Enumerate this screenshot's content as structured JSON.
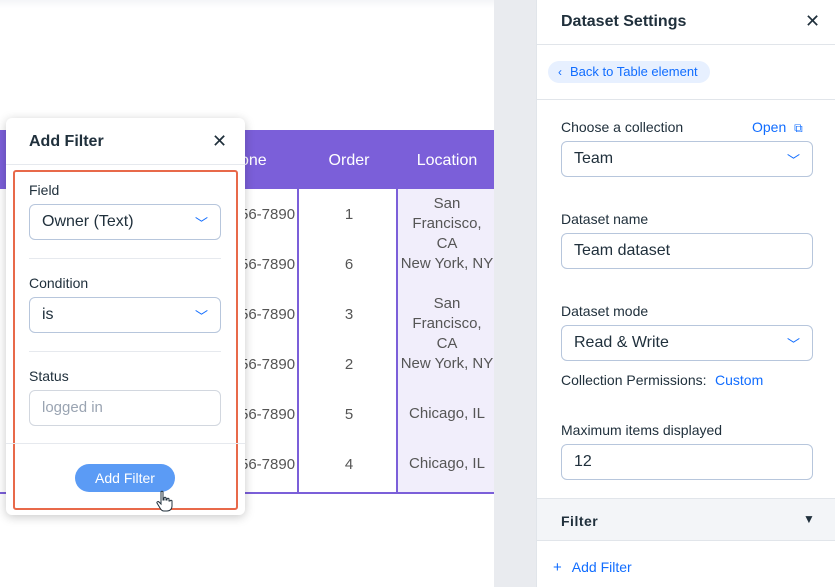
{
  "table": {
    "headers": {
      "phone": "one",
      "order": "Order",
      "location": "Location"
    },
    "rows": [
      {
        "phone": "56-7890",
        "order": "1",
        "location_line1": "San Francisco,",
        "location_line2": "CA"
      },
      {
        "phone": "56-7890",
        "order": "6",
        "location_line1": "New York, NY",
        "location_line2": ""
      },
      {
        "phone": "56-7890",
        "order": "3",
        "location_line1": "San Francisco,",
        "location_line2": "CA"
      },
      {
        "phone": "56-7890",
        "order": "2",
        "location_line1": "New York, NY",
        "location_line2": ""
      },
      {
        "phone": "56-7890",
        "order": "5",
        "location_line1": "Chicago, IL",
        "location_line2": ""
      },
      {
        "phone": "56-7890",
        "order": "4",
        "location_line1": "Chicago, IL",
        "location_line2": ""
      }
    ]
  },
  "add_filter_popup": {
    "title": "Add Filter",
    "close_icon": "close-icon",
    "field_label": "Field",
    "field_value": "Owner (Text)",
    "condition_label": "Condition",
    "condition_value": "is",
    "status_label": "Status",
    "status_placeholder": "logged in",
    "submit_label": "Add Filter"
  },
  "panel": {
    "title": "Dataset Settings",
    "back_label": "Back to Table element",
    "collection_label": "Choose a collection",
    "open_link": "Open",
    "collection_value": "Team",
    "dataset_name_label": "Dataset name",
    "dataset_name_value": "Team dataset",
    "dataset_mode_label": "Dataset mode",
    "dataset_mode_value": "Read & Write",
    "permissions_label": "Collection Permissions:",
    "permissions_value": "Custom",
    "max_items_label": "Maximum items displayed",
    "max_items_value": "12",
    "filter_section": "Filter",
    "add_filter_link": "Add Filter"
  },
  "colors": {
    "table_header": "#7b5fd9",
    "accent_blue": "#116dff",
    "highlight": "#e8694a",
    "button_blue": "#5b9bf5"
  }
}
